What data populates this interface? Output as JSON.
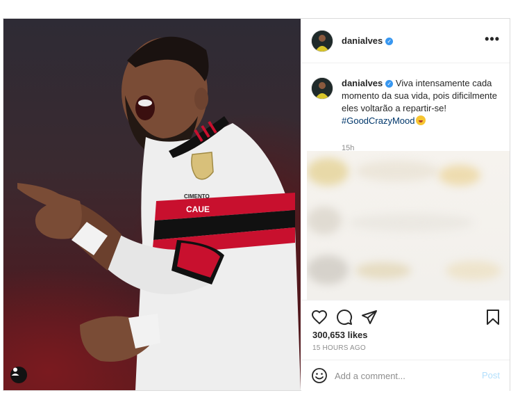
{
  "post": {
    "username": "danialves",
    "verified_mark": "✓",
    "more_label": "•••",
    "caption": {
      "username": "danialves",
      "text": "Viva intensamente cada momento da sua vida, pois dificilmente eles voltarão a repartir-se!",
      "hashtag": "#GoodCrazyMood",
      "emoji_icon": "grinning-face-emoji",
      "time": "15h"
    },
    "photo": {
      "avatar_icon": "user-avatar-icon",
      "shirt_sponsor_line1": "CIMENTO",
      "shirt_sponsor_line2": "CAUE"
    },
    "actions": {
      "like_icon": "heart-icon",
      "comment_icon": "comment-bubble-icon",
      "share_icon": "paper-plane-icon",
      "save_icon": "bookmark-icon"
    },
    "likes": "300,653 likes",
    "timestamp": "15 HOURS AGO",
    "comment_box": {
      "emoji_icon": "smiley-icon",
      "placeholder": "Add a comment...",
      "post_label": "Post"
    }
  },
  "colors": {
    "verified": "#3897f0",
    "hashtag": "#00376b",
    "post_button_disabled": "#b2dffc",
    "muted_text": "#8e8e8e",
    "shirt_red": "#c8102e"
  }
}
